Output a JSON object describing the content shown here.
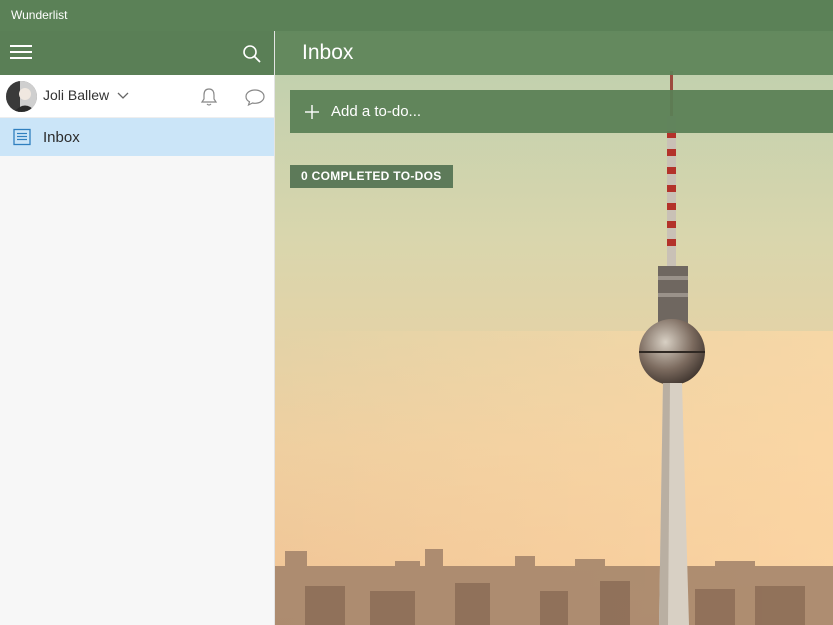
{
  "window": {
    "title": "Wunderlist"
  },
  "sidebar": {
    "user": {
      "name": "Joli Ballew"
    },
    "lists": [
      {
        "label": "Inbox",
        "icon": "inbox-icon"
      }
    ]
  },
  "main": {
    "title": "Inbox",
    "add_placeholder": "Add a to-do...",
    "completed_label": "0 COMPLETED TO-DOS"
  },
  "colors": {
    "accent_green": "#5a7f56",
    "selected_list": "#cbe5f8"
  }
}
